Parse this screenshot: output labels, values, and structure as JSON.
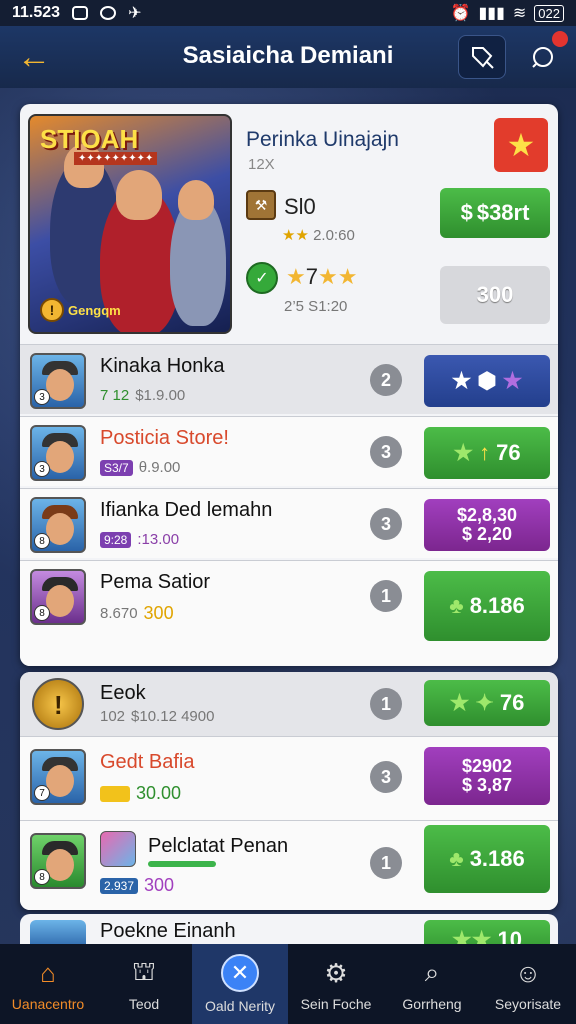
{
  "status": {
    "time": "11.523",
    "right_text": "022"
  },
  "header": {
    "title": "Sasiaicha Demiani",
    "back_icon": "arrow-left-icon",
    "notif_count": ""
  },
  "featured": {
    "hero_title": "STIOAH",
    "hero_badge": "Gengqm",
    "name": "Perinka Uinajajn",
    "sub": "12X",
    "row1_label": "Sl0",
    "row1_sub": "2.0:60",
    "row1_button": "$38rt",
    "row2_label": "7",
    "row2_sub": "2’5 S1:20",
    "row2_button": "300"
  },
  "rows": [
    {
      "name": "Kinaka Honka",
      "tag": "7 12",
      "sub": "$1.9.00",
      "rank": "2",
      "button": "",
      "style": "navy",
      "num": "3"
    },
    {
      "name": "Posticia Store!",
      "tag": "S3/7",
      "sub": "θ.9.00",
      "rank": "3",
      "button": "76",
      "style": "green",
      "num": "3"
    },
    {
      "name": "Ifianka Ded lemahn",
      "tag": "9:28",
      "sub": ":13.00",
      "rank": "3",
      "button": "$2,8,30\n$ 2,20",
      "style": "purple",
      "num": "8"
    },
    {
      "name": "Pema Satior",
      "tag": "8.670",
      "sub": "300",
      "rank": "1",
      "button": "8.186",
      "style": "green",
      "num": "8"
    },
    {
      "name": "Eeok",
      "tag": "102",
      "sub": "$10.12 4900",
      "rank": "1",
      "button": "76",
      "style": "green",
      "num": ""
    },
    {
      "name": "Gedt Bafia",
      "tag": "",
      "sub": "30.00",
      "rank": "3",
      "button": "$2902\n$ 3,87",
      "style": "purple",
      "num": "7"
    },
    {
      "name": "Pelclatat Penan",
      "tag": "2.937",
      "sub": "300",
      "rank": "1",
      "button": "3.186",
      "style": "green",
      "num": "8"
    },
    {
      "name": "Poekne Einanh",
      "tag": "",
      "sub": "",
      "rank": "",
      "button": "10",
      "style": "green",
      "num": ""
    }
  ],
  "nav": [
    {
      "label": "Uanacentro",
      "icon": "home-icon",
      "active": false
    },
    {
      "label": "Teod",
      "icon": "castle-icon",
      "active": false
    },
    {
      "label": "Oald Nerity",
      "icon": "close-circle-icon",
      "active": true
    },
    {
      "label": "Sein Foche",
      "icon": "gear-icon",
      "active": false
    },
    {
      "label": "Gorrheng",
      "icon": "search-icon",
      "active": false
    },
    {
      "label": "Seyorisate",
      "icon": "user-icon",
      "active": false
    }
  ]
}
